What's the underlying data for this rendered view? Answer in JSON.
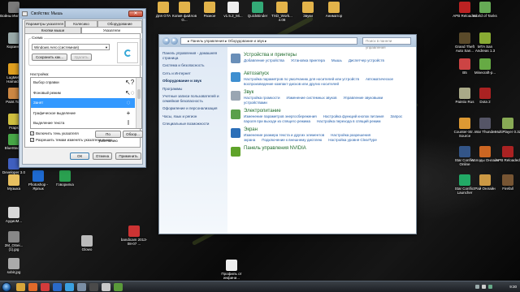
{
  "desktop_icons": [
    {
      "label": "Войны Империй"
    },
    {
      "label": "Корзина"
    },
    {
      "label": "LogMeIn Hamachi"
    },
    {
      "label": "Paint.Tool"
    },
    {
      "label": "Fraps"
    },
    {
      "label": "BlueStacks"
    },
    {
      "label": "Developer 3.0 (с)"
    },
    {
      "label": "Музыка"
    },
    {
      "label": "АудиоМ..."
    },
    {
      "label": "2M_OSei...(1).jpg"
    },
    {
      "label": "sobit.jpg"
    },
    {
      "label": "Photoshop - Ярлык"
    },
    {
      "label": "Говорилка"
    },
    {
      "label": "Glowo"
    },
    {
      "label": "bandicam 2013-08-07 ..."
    },
    {
      "label": "Профиль от инфини..."
    },
    {
      "label": "Для GTA"
    },
    {
      "label": "Копия файлов G..."
    },
    {
      "label": "Разное"
    },
    {
      "label": "v1.5.2_Mi..."
    },
    {
      "label": "QuickBinder"
    },
    {
      "label": "TXD_Work... 4.08"
    },
    {
      "label": "Звуки"
    },
    {
      "label": "Аниматор"
    },
    {
      "label": "APB Reloaded"
    },
    {
      "label": "World of Tanks"
    },
    {
      "label": "Grand Theft Auto San..."
    },
    {
      "label": "MTA San Andreas 1.3"
    },
    {
      "label": "Minecraft-p..."
    },
    {
      "label": "B5"
    },
    {
      "label": "Dota 2"
    },
    {
      "label": "Paintio Rus"
    },
    {
      "label": "Counter-Str... Source"
    },
    {
      "label": "War Thunder"
    },
    {
      "label": "MultiPlayer 0.3z"
    },
    {
      "label": "Star Conflict Online"
    },
    {
      "label": "Аллоды Онлайн"
    },
    {
      "label": "APB Reloaded"
    },
    {
      "label": "Star Conflict Launcher"
    },
    {
      "label": "Рай Онлайн"
    },
    {
      "label": "Firefall"
    }
  ],
  "explorer": {
    "address": "▸ Панель управления ▸ Оборудование и звук ▸",
    "search_placeholder": "Поиск в панели управления",
    "nav": {
      "back": "◄",
      "forward": "►"
    },
    "sidebar": [
      {
        "label": "Панель управления - домашняя страница",
        "active": false
      },
      {
        "label": "Система и безопасность",
        "active": false
      },
      {
        "label": "Сеть и Интернет",
        "active": false
      },
      {
        "label": "Оборудование и звук",
        "active": true
      },
      {
        "label": "Программы",
        "active": false
      },
      {
        "label": "Учетные записи пользователей и семейная безопасность",
        "active": false
      },
      {
        "label": "Оформление и персонализация",
        "active": false
      },
      {
        "label": "Часы, язык и регион",
        "active": false
      },
      {
        "label": "Специальные возможности",
        "active": false
      }
    ],
    "categories": [
      {
        "title": "Устройства и принтеры",
        "links": [
          "Добавление устройства",
          "Установка принтера",
          "Мышь",
          "Диспетчер устройств"
        ],
        "color": "#6a8fb8"
      },
      {
        "title": "Автозапуск",
        "links": [
          "Настройка параметров по умолчанию для носителей или устройств",
          "Автоматическое воспроизведение компакт-дисков или других носителей"
        ],
        "color": "#3f8fd0"
      },
      {
        "title": "Звук",
        "links": [
          "Настройка громкости",
          "Изменение системных звуков",
          "Управление звуковыми устройствами"
        ],
        "color": "#9aa6b2"
      },
      {
        "title": "Электропитание",
        "links": [
          "Изменение параметров энергосбережения",
          "Настройка функций кнопок питания",
          "Запрос пароля при выходе из спящего режима",
          "Настройка перехода в спящий режим"
        ],
        "color": "#5aa04a"
      },
      {
        "title": "Экран",
        "links": [
          "Изменение размера текста и других элементов",
          "Настройка разрешения экрана",
          "Подключение к внешнему дисплею",
          "Настройка уровня ClearType"
        ],
        "color": "#2c6fb8"
      },
      {
        "title": "Панель управления NVIDIA",
        "links": [],
        "color": "#5fa32a"
      }
    ]
  },
  "mouse_dialog": {
    "title": "Свойства: Мышь",
    "close_glyph": "✕",
    "tabs_row1": [
      "Параметры указателя",
      "Колесико",
      "Оборудование"
    ],
    "tabs_row2": [
      "Кнопки мыши",
      "Указатели"
    ],
    "scheme_group_label": "Схема",
    "scheme_value": "Windows Aero (системная)",
    "save_as": "Сохранить как...",
    "delete": "Удалить",
    "customize_label": "Настройка:",
    "pointers": [
      {
        "label": "Выбор справки",
        "glyph": "↖?",
        "selected": false
      },
      {
        "label": "Фоновый режим",
        "glyph": "↖◌",
        "selected": false
      },
      {
        "label": "Занят",
        "glyph": "◌",
        "selected": true
      },
      {
        "label": "Графическое выделение",
        "glyph": "+",
        "selected": false
      },
      {
        "label": "Выделение текста",
        "glyph": "I",
        "selected": false
      }
    ],
    "enable_shadow": "Включить тень указателя",
    "allow_themes": "Разрешить темам изменять указатели мыши",
    "default_btn": "По умолчанию",
    "browse_btn": "Обзор...",
    "ok": "ОК",
    "cancel": "Отмена",
    "apply": "Применить"
  },
  "taskbar": {
    "start_label": "Пуск",
    "apps": [
      {
        "name": "explorer",
        "color": "#d8a53a"
      },
      {
        "name": "media",
        "color": "#e06a2a"
      },
      {
        "name": "browser",
        "color": "#d23b3b"
      },
      {
        "name": "photoshop",
        "color": "#2a6ac8"
      },
      {
        "name": "skype",
        "color": "#3aa0e0"
      },
      {
        "name": "app6",
        "color": "#7a8ea5"
      },
      {
        "name": "app7",
        "color": "#4a4a4a"
      },
      {
        "name": "app8",
        "color": "#c8c8c8"
      },
      {
        "name": "app9",
        "color": "#5a9a3a"
      }
    ],
    "clock": "9:30"
  }
}
